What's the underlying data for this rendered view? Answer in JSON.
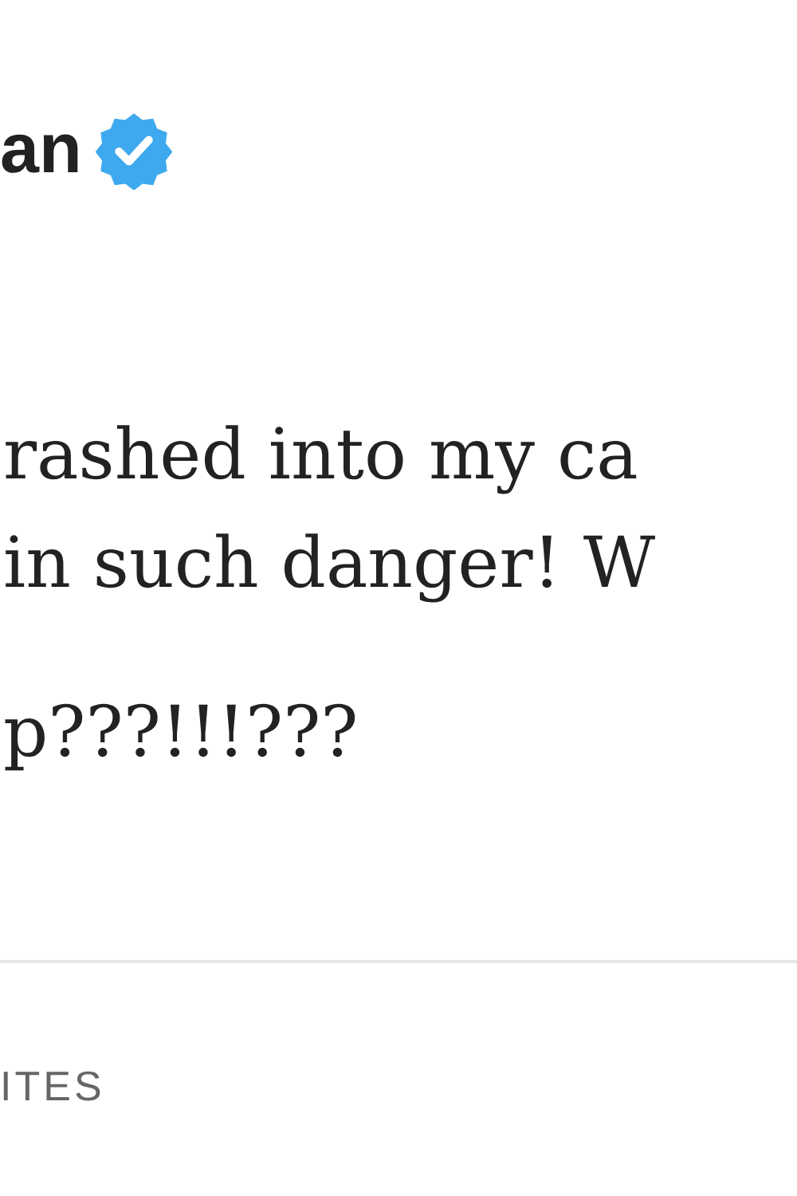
{
  "author": {
    "name": "an",
    "verified": true
  },
  "tweet": {
    "lines": [
      "rashed into my ca",
      "in such danger! W",
      "p???!!!???"
    ]
  },
  "stats": {
    "label": "ITES"
  }
}
